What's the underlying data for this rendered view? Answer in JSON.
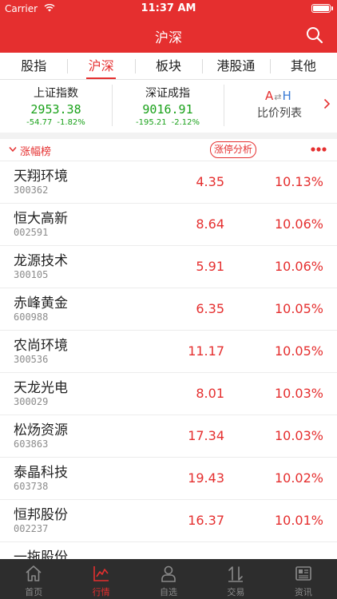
{
  "status_bar": {
    "carrier": "Carrier",
    "time": "11:37 AM"
  },
  "nav": {
    "title": "沪深"
  },
  "tabs": [
    {
      "label": "股指"
    },
    {
      "label": "沪深",
      "active": true
    },
    {
      "label": "板块"
    },
    {
      "label": "港股通"
    },
    {
      "label": "其他"
    }
  ],
  "indices": [
    {
      "name": "上证指数",
      "value": "2953.38",
      "change": "-54.77",
      "percent": "-1.82%"
    },
    {
      "name": "深证成指",
      "value": "9016.91",
      "change": "-195.21",
      "percent": "-2.12%"
    }
  ],
  "ah_compare": {
    "logo_a": "A",
    "logo_mid": "⇄",
    "logo_h": "H",
    "label": "比价列表"
  },
  "section": {
    "title": "涨幅榜",
    "analysis_button": "涨停分析"
  },
  "stocks": [
    {
      "name": "天翔环境",
      "code": "300362",
      "price": "4.35",
      "change_pct": "10.13%"
    },
    {
      "name": "恒大高新",
      "code": "002591",
      "price": "8.64",
      "change_pct": "10.06%"
    },
    {
      "name": "龙源技术",
      "code": "300105",
      "price": "5.91",
      "change_pct": "10.06%"
    },
    {
      "name": "赤峰黄金",
      "code": "600988",
      "price": "6.35",
      "change_pct": "10.05%"
    },
    {
      "name": "农尚环境",
      "code": "300536",
      "price": "11.17",
      "change_pct": "10.05%"
    },
    {
      "name": "天龙光电",
      "code": "300029",
      "price": "8.01",
      "change_pct": "10.03%"
    },
    {
      "name": "松炀资源",
      "code": "603863",
      "price": "17.34",
      "change_pct": "10.03%"
    },
    {
      "name": "泰晶科技",
      "code": "603738",
      "price": "19.43",
      "change_pct": "10.02%"
    },
    {
      "name": "恒邦股份",
      "code": "002237",
      "price": "16.37",
      "change_pct": "10.01%"
    },
    {
      "name": "一拖股份",
      "code": "",
      "price": "",
      "change_pct": ""
    }
  ],
  "tab_bar": [
    {
      "label": "首页",
      "icon": "home-icon"
    },
    {
      "label": "行情",
      "icon": "market-chart-icon",
      "active": true
    },
    {
      "label": "自选",
      "icon": "user-icon"
    },
    {
      "label": "交易",
      "icon": "trade-arrows-icon"
    },
    {
      "label": "资讯",
      "icon": "news-icon"
    }
  ],
  "colors": {
    "brand_red": "#e52f2f",
    "down_green": "#19a119",
    "tab_bar_bg": "#2d2d2d"
  }
}
